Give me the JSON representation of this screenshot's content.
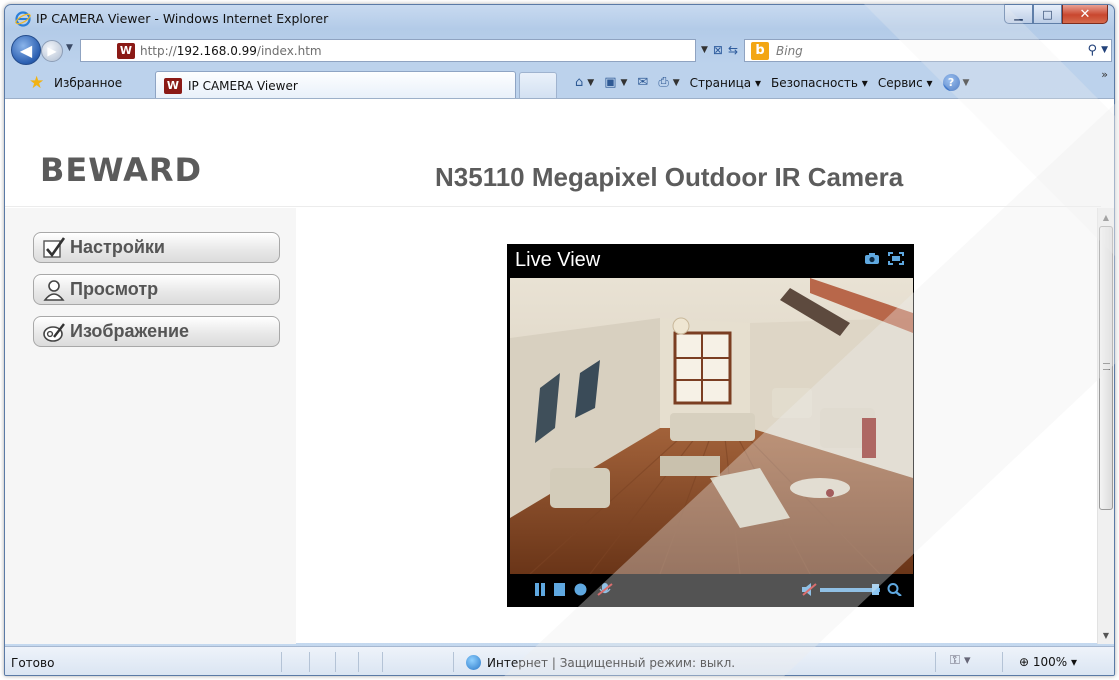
{
  "window": {
    "title": "IP CAMERA Viewer - Windows Internet Explorer",
    "controls": {
      "minimize": "▁",
      "maximize": "□",
      "close": "✕"
    }
  },
  "addressbar": {
    "url_prefix": "http://",
    "url_host": "192.168.0.99",
    "url_path": "/index.htm",
    "search_placeholder": "Bing"
  },
  "favorites": {
    "label": "Избранное",
    "tab_title": "IP CAMERA Viewer"
  },
  "commandbar": {
    "page": "Страница",
    "safety": "Безопасность",
    "service": "Сервис"
  },
  "page": {
    "logo": "BEWARD",
    "camera_title": "N35110 Megapixel Outdoor IR Camera",
    "menu": [
      {
        "label": "Настройки",
        "icon": "checkmark-icon"
      },
      {
        "label": "Просмотр",
        "icon": "user-icon"
      },
      {
        "label": "Изображение",
        "icon": "image-edit-icon"
      }
    ],
    "player": {
      "title": "Live View",
      "header_icons": [
        "snapshot-camera-icon",
        "fullscreen-icon"
      ],
      "controls": [
        "pause-icon",
        "stop-icon",
        "record-icon",
        "mic-off-icon",
        "speaker-mute-icon",
        "volume-slider",
        "zoom-icon"
      ]
    }
  },
  "statusbar": {
    "ready": "Готово",
    "zone": "Интернет | Защищенный режим: выкл.",
    "zoom": "100%"
  },
  "colors": {
    "window_frame": "#b3cbe8",
    "menu_panel": "#f6f6f6",
    "header_text": "#5c5c5c",
    "player_bg": "#000000"
  }
}
